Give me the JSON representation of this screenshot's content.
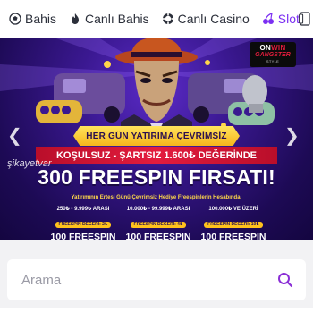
{
  "nav": {
    "items": [
      {
        "label": "Bahis",
        "icon": "soccer-ball-icon"
      },
      {
        "label": "Canlı Bahis",
        "icon": "flame-icon"
      },
      {
        "label": "Canlı Casino",
        "icon": "poker-chip-icon"
      },
      {
        "label": "Slot",
        "icon": "cherry-icon"
      }
    ],
    "active_index": 3,
    "accent_color": "#7b2ff2"
  },
  "banner": {
    "brand_top_a": "ON",
    "brand_top_b": "WIN",
    "brand_mid": "GANGSTER",
    "brand_sub": "STYLE",
    "ribbon": "HER GÜN YATIRIMA ÇEVRİMSİZ",
    "condition": "KOŞULSUZ - ŞARTSIZ 1.600₺ DEĞERİNDE",
    "headline": "300 FREESPIN FIRSATI!",
    "subline": "Yatırımının Ertesi Günü Çevrimsiz Hediye Freespinlerin Hesabında!",
    "watermark": "şikayetvar",
    "tiers": [
      {
        "range": "250₺ - 9.999₺ ARASI",
        "pill": "FREESPIN DEĞERİ: 2₺",
        "amount": "100 FREESPIN"
      },
      {
        "range": "10.000₺ - 99.999₺ ARASI",
        "pill": "FREESPIN DEĞERİ: 4₺",
        "amount": "100 FREESPIN"
      },
      {
        "range": "100.000₺ VE ÜZERİ",
        "pill": "FREESPIN DEĞERİ: 10₺",
        "amount": "100 FREESPIN"
      }
    ]
  },
  "search": {
    "placeholder": "Arama",
    "icon": "search-icon",
    "icon_color": "#8b2fd6"
  }
}
